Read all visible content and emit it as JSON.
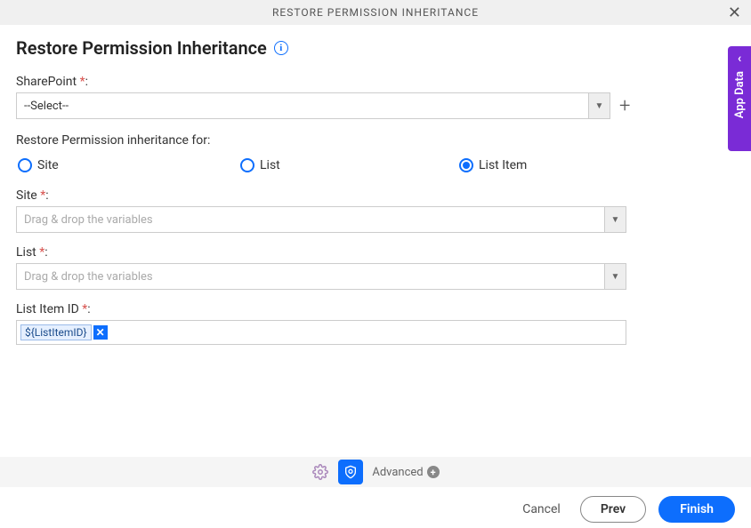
{
  "header": {
    "title": "RESTORE PERMISSION INHERITANCE"
  },
  "page": {
    "title": "Restore Permission Inheritance"
  },
  "sharepoint": {
    "label": "SharePoint",
    "selected": "--Select--"
  },
  "restoreFor": {
    "label": "Restore Permission inheritance for:",
    "options": [
      "Site",
      "List",
      "List Item"
    ],
    "selected": "List Item"
  },
  "site": {
    "label": "Site",
    "placeholder": "Drag & drop the variables"
  },
  "list": {
    "label": "List",
    "placeholder": "Drag & drop the variables"
  },
  "listItemId": {
    "label": "List Item ID",
    "chip": "${ListItemID}"
  },
  "footer": {
    "advanced": "Advanced"
  },
  "buttons": {
    "cancel": "Cancel",
    "prev": "Prev",
    "finish": "Finish"
  },
  "sidebar": {
    "label": "App Data"
  }
}
